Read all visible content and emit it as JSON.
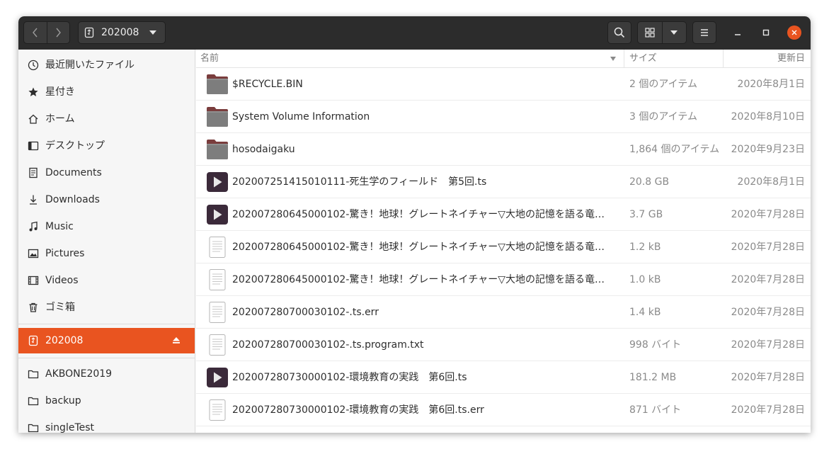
{
  "headerbar": {
    "location": "202008",
    "nav_back_icon": "chevron-left-icon",
    "nav_forward_icon": "chevron-right-icon",
    "location_icon": "usb-drive-icon",
    "search_icon": "search-icon",
    "view_icon": "grid-view-icon",
    "menu_icon": "hamburger-menu-icon",
    "close_color": "#e95420"
  },
  "sidebar": {
    "places": [
      {
        "label": "最近開いたファイル",
        "icon": "clock-icon"
      },
      {
        "label": "星付き",
        "icon": "star-icon"
      },
      {
        "label": "ホーム",
        "icon": "home-icon"
      },
      {
        "label": "デスクトップ",
        "icon": "desktop-icon"
      },
      {
        "label": "Documents",
        "icon": "document-icon"
      },
      {
        "label": "Downloads",
        "icon": "download-icon"
      },
      {
        "label": "Music",
        "icon": "music-icon"
      },
      {
        "label": "Pictures",
        "icon": "picture-icon"
      },
      {
        "label": "Videos",
        "icon": "video-icon"
      },
      {
        "label": "ゴミ箱",
        "icon": "trash-icon"
      }
    ],
    "devices": [
      {
        "label": "202008",
        "icon": "usb-drive-icon",
        "active": true,
        "eject_icon": "eject-icon"
      }
    ],
    "bookmarks": [
      {
        "label": "AKBONE2019",
        "icon": "folder-icon"
      },
      {
        "label": "backup",
        "icon": "folder-icon"
      },
      {
        "label": "singleTest",
        "icon": "folder-icon"
      }
    ],
    "accent": "#e95420"
  },
  "columns": {
    "name": "名前",
    "size": "サイズ",
    "modified": "更新日"
  },
  "files": [
    {
      "name": "$RECYCLE.BIN",
      "size": "2 個のアイテム",
      "date": "2020年8月1日",
      "kind": "folder"
    },
    {
      "name": "System Volume Information",
      "size": "3 個のアイテム",
      "date": "2020年8月10日",
      "kind": "folder"
    },
    {
      "name": "hosodaigaku",
      "size": "1,864 個のアイテム",
      "date": "2020年9月23日",
      "kind": "folder"
    },
    {
      "name": "202007251415010111-死生学のフィールド　第5回.ts",
      "size": "20.8 GB",
      "date": "2020年8月1日",
      "kind": "video"
    },
    {
      "name": "202007280645000102-驚き！地球！グレートネイチャー▽大地の記憶を語る竜…",
      "size": "3.7 GB",
      "date": "2020年7月28日",
      "kind": "video"
    },
    {
      "name": "202007280645000102-驚き！地球！グレートネイチャー▽大地の記憶を語る竜…",
      "size": "1.2 kB",
      "date": "2020年7月28日",
      "kind": "text"
    },
    {
      "name": "202007280645000102-驚き！地球！グレートネイチャー▽大地の記憶を語る竜…",
      "size": "1.0 kB",
      "date": "2020年7月28日",
      "kind": "text"
    },
    {
      "name": "202007280700030102-.ts.err",
      "size": "1.4 kB",
      "date": "2020年7月28日",
      "kind": "text"
    },
    {
      "name": "202007280700030102-.ts.program.txt",
      "size": "998 バイト",
      "date": "2020年7月28日",
      "kind": "text"
    },
    {
      "name": "202007280730000102-環境教育の実践　第6回.ts",
      "size": "181.2 MB",
      "date": "2020年7月28日",
      "kind": "video"
    },
    {
      "name": "202007280730000102-環境教育の実践　第6回.ts.err",
      "size": "871 バイト",
      "date": "2020年7月28日",
      "kind": "text"
    }
  ]
}
